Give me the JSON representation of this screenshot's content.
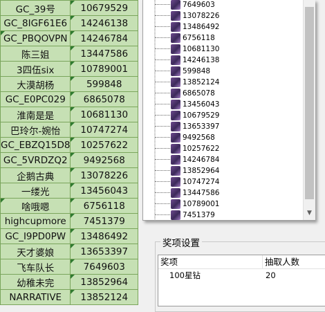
{
  "sheet": {
    "rows": [
      {
        "name": "GC_39号",
        "id": "10679529",
        "marked": false
      },
      {
        "name": "GC_8IGF61E6",
        "id": "14246138",
        "marked": false
      },
      {
        "name": "GC_PBQOVPN",
        "id": "14246784",
        "marked": true
      },
      {
        "name": "陈三姐",
        "id": "13447586",
        "marked": false
      },
      {
        "name": "3四伍six",
        "id": "10789001",
        "marked": false
      },
      {
        "name": "大漠胡杨",
        "id": "599848",
        "marked": false
      },
      {
        "name": "GC_E0PC029",
        "id": "6865078",
        "marked": false
      },
      {
        "name": "淮南是是",
        "id": "10681130",
        "marked": false
      },
      {
        "name": "巴玲尔-婉怡",
        "id": "10747274",
        "marked": false
      },
      {
        "name": "GC_EBZQ15D8",
        "id": "10257622",
        "marked": false
      },
      {
        "name": "GC_5VRDZQ2",
        "id": "9492568",
        "marked": false
      },
      {
        "name": "企鹅古典",
        "id": "13078226",
        "marked": false
      },
      {
        "name": "一缕光",
        "id": "13456043",
        "marked": false
      },
      {
        "name": "啥哦嗯",
        "id": "6756118",
        "marked": true
      },
      {
        "name": "highcupmore",
        "id": "7451379",
        "marked": false
      },
      {
        "name": "GC_I9PD0PW",
        "id": "13486492",
        "marked": false
      },
      {
        "name": "天才婆娘",
        "id": "13653397",
        "marked": false
      },
      {
        "name": "飞车队长",
        "id": "7649603",
        "marked": false
      },
      {
        "name": "幼稚未完",
        "id": "13852964",
        "marked": false
      },
      {
        "name": "NARRATIVE",
        "id": "13852124",
        "marked": false
      }
    ]
  },
  "tree": {
    "items": [
      "7649603",
      "13078226",
      "13486492",
      "6756118",
      "10681130",
      "14246138",
      "599848",
      "13852124",
      "6865078",
      "13456043",
      "10679529",
      "13653397",
      "9492568",
      "10257622",
      "14246784",
      "13852964",
      "10747274",
      "13447586",
      "10789001",
      "7451379"
    ]
  },
  "prize_settings": {
    "title": "奖项设置",
    "columns": {
      "prize": "奖项",
      "count": "抽取人数"
    },
    "rows": [
      {
        "prize": "100星钻",
        "count": "20"
      }
    ]
  },
  "colors": {
    "cell_fill": "#c6e0b4",
    "cell_border": "#7aa55c",
    "comment_marker": "#2f7a2f"
  },
  "icons": {
    "tree_item": "purple-flower-thumbnail-icon",
    "scroll_down": "chevron-down-icon"
  }
}
